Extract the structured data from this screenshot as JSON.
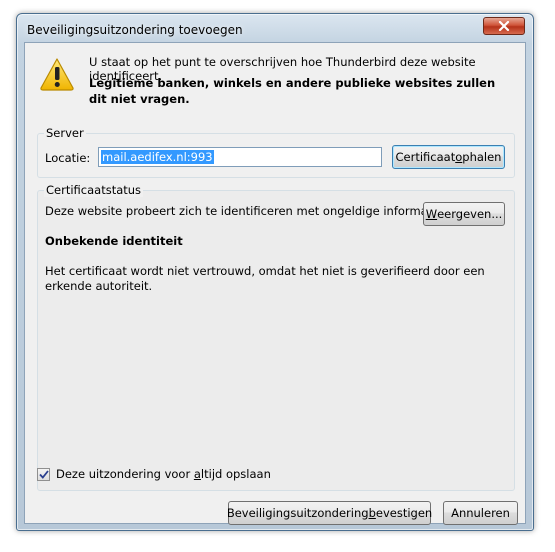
{
  "window": {
    "title": "Beveiligingsuitzondering toevoegen"
  },
  "intro": {
    "line1": "U staat op het punt te overschrijven hoe Thunderbird deze website identificeert.",
    "line2": "Legitieme banken, winkels en andere publieke websites zullen dit niet vragen."
  },
  "server": {
    "group_label": "Server",
    "location_label": "Locatie:",
    "location_value": "mail.aedifex.nl:993",
    "get_cert_pre": "Certificaat ",
    "get_cert_access": "o",
    "get_cert_post": "phalen"
  },
  "status": {
    "group_label": "Certificaatstatus",
    "message": "Deze website probeert zich te identificeren met ongeldige informatie.",
    "view_access": "W",
    "view_post": "eergeven...",
    "identity_title": "Onbekende identiteit",
    "identity_detail": "Het certificaat wordt niet vertrouwd, omdat het niet is geverifieerd door een erkende autoriteit."
  },
  "permanent": {
    "checked": true,
    "label_pre": "Deze uitzondering voor ",
    "label_access": "a",
    "label_post": "ltijd opslaan"
  },
  "buttons": {
    "confirm_pre": "Beveiligingsuitzondering ",
    "confirm_access": "b",
    "confirm_post": "evestigen",
    "cancel": "Annuleren"
  },
  "colors": {
    "accent": "#3399ff",
    "warning": "#f5c400",
    "close": "#c9462c"
  }
}
